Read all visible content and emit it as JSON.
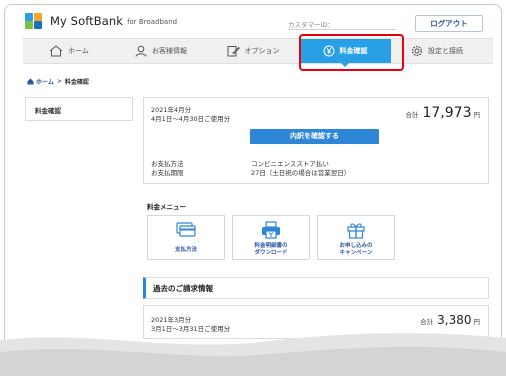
{
  "header": {
    "app_title": "My SoftBank",
    "app_subtitle": "for Broadband",
    "customer_id_label": "カスタマーID：",
    "logout_label": "ログアウト"
  },
  "nav": {
    "items": [
      {
        "label": "ホーム",
        "icon": "home-icon"
      },
      {
        "label": "お客様情報",
        "icon": "user-icon"
      },
      {
        "label": "オプション",
        "icon": "edit-icon"
      },
      {
        "label": "料金確認",
        "icon": "yen-coin-icon",
        "active": true
      },
      {
        "label": "設定と接続",
        "icon": "gear-icon"
      }
    ]
  },
  "breadcrumb": {
    "home": "ホーム",
    "separator": ">",
    "current": "料金確認"
  },
  "sidebar": {
    "items": [
      {
        "label": "料金確認"
      }
    ]
  },
  "billing": {
    "month": "2021年4月分",
    "period": "4月1日～4月30日ご使用分",
    "total_label": "合計",
    "total_amount": "17,973",
    "currency": "円",
    "confirm_button": "内訳を確認する",
    "payment_method_label": "お支払方法",
    "payment_date_label": "お支払期限",
    "payment_method_value": "コンビニエンスストア払い",
    "payment_date_value": "27日（土日祝の場合は営業翌日）"
  },
  "menu": {
    "title": "料金メニュー",
    "tiles": [
      {
        "label_lines": [
          "支払方法"
        ],
        "icon": "credit-card-icon"
      },
      {
        "label_lines": [
          "料金明細書の",
          "ダウンロード"
        ],
        "icon": "printer-icon"
      },
      {
        "label_lines": [
          "お申し込みの",
          "キャンペーン"
        ],
        "icon": "gift-icon"
      }
    ]
  },
  "history": {
    "title": "過去のご請求情報",
    "rows": [
      {
        "month": "2021年3月分",
        "period": "3月1日～3月31日ご使用分",
        "total_label": "合計",
        "amount": "3,380",
        "currency": "円"
      }
    ]
  },
  "colors": {
    "accent": "#29a0e6",
    "button_blue": "#2e87d6",
    "highlight_red": "#e60012",
    "link_blue": "#2a56a6"
  }
}
